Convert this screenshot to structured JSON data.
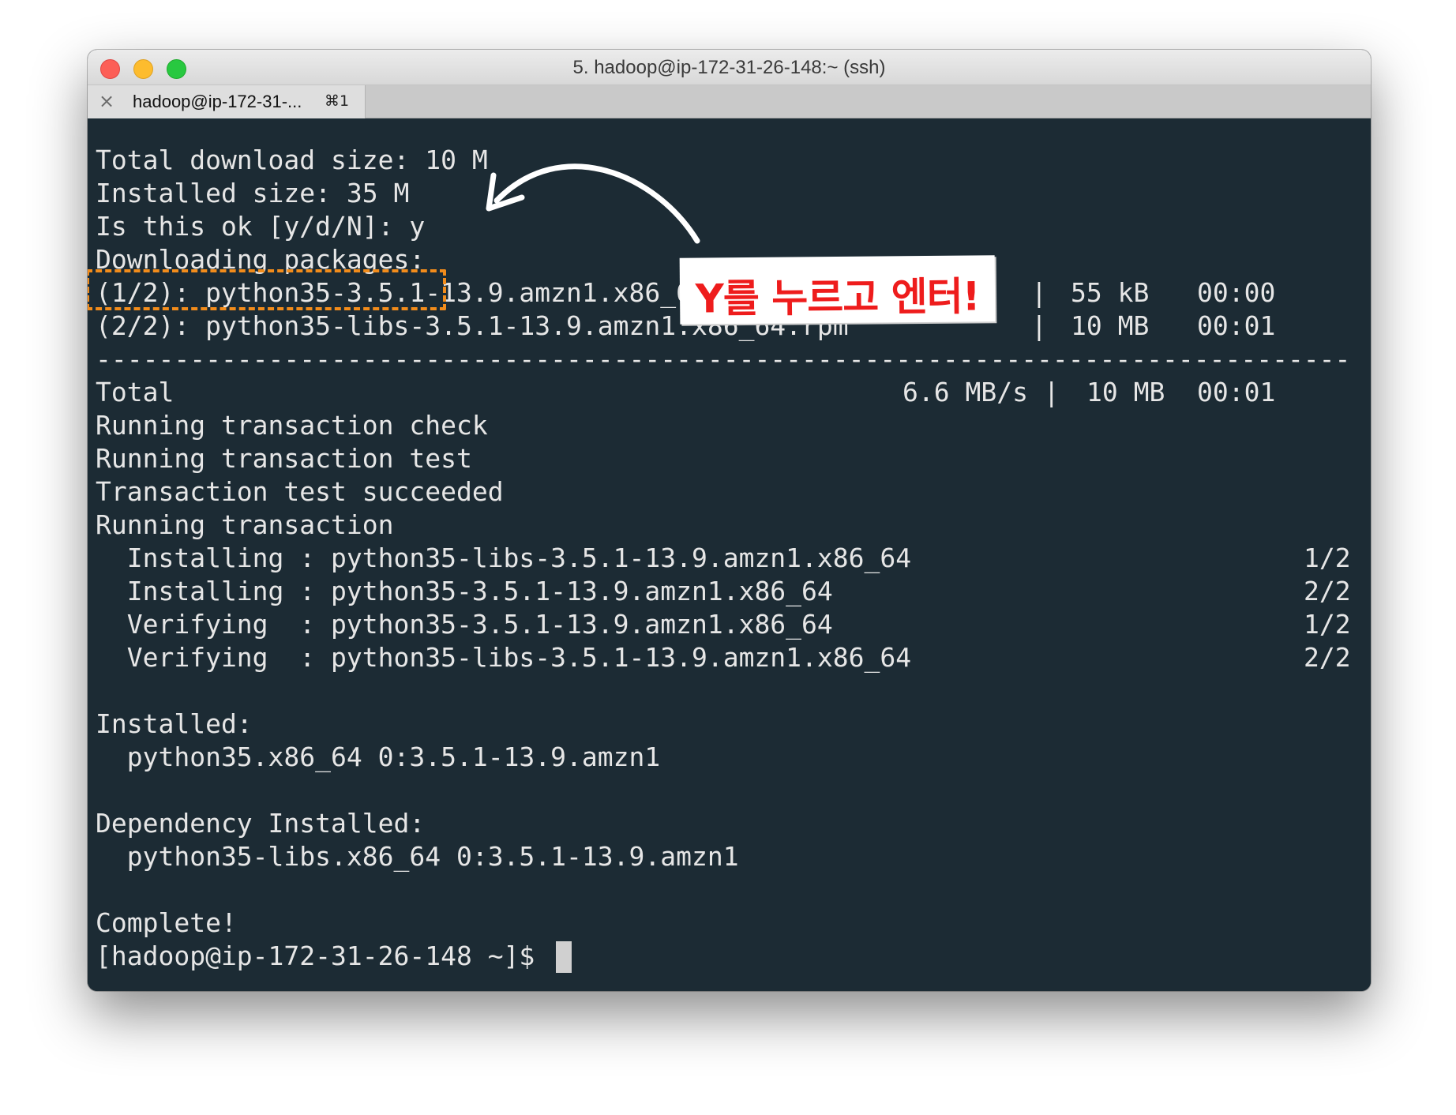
{
  "window": {
    "title": "5. hadoop@ip-172-31-26-148:~ (ssh)"
  },
  "tab": {
    "label": "hadoop@ip-172-31-...",
    "shortcut": "⌘1"
  },
  "terminal": {
    "download_size": "Total download size: 10 M",
    "installed_size": "Installed size: 35 M",
    "prompt_ok": "Is this ok [y/d/N]: y",
    "downloading": "Downloading packages:",
    "pkg1": {
      "name": "(1/2): python35-3.5.1-13.9.amzn1.x86_64.rpm",
      "sep": "|",
      "size": "55 kB",
      "time": "00:00"
    },
    "pkg2": {
      "name": "(2/2): python35-libs-3.5.1-13.9.amzn1.x86_64.rpm",
      "sep": "|",
      "size": "10 MB",
      "time": "00:01"
    },
    "divider": "--------------------------------------------------------------------------------",
    "total": {
      "label": "Total",
      "rate": "6.6 MB/s |",
      "size": "10 MB",
      "time": "00:01"
    },
    "check": "Running transaction check",
    "test": "Running transaction test",
    "test_ok": "Transaction test succeeded",
    "running": "Running transaction",
    "steps": [
      {
        "text": "  Installing : python35-libs-3.5.1-13.9.amzn1.x86_64",
        "count": "1/2"
      },
      {
        "text": "  Installing : python35-3.5.1-13.9.amzn1.x86_64",
        "count": "2/2"
      },
      {
        "text": "  Verifying  : python35-3.5.1-13.9.amzn1.x86_64",
        "count": "1/2"
      },
      {
        "text": "  Verifying  : python35-libs-3.5.1-13.9.amzn1.x86_64",
        "count": "2/2"
      }
    ],
    "installed_header": "Installed:",
    "installed_pkg": "  python35.x86_64 0:3.5.1-13.9.amzn1",
    "dep_header": "Dependency Installed:",
    "dep_pkg": "  python35-libs.x86_64 0:3.5.1-13.9.amzn1",
    "complete": "Complete!",
    "shell_prompt": "[hadoop@ip-172-31-26-148 ~]$ "
  },
  "annotation": {
    "callout_text": "Y를 누르고 엔터!",
    "highlight_color": "#f28c1b",
    "callout_color": "#ee1c1c"
  }
}
